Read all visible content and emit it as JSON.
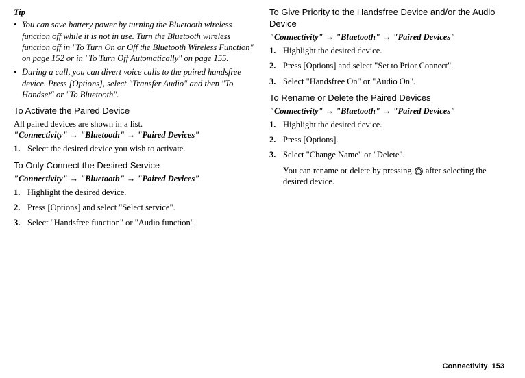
{
  "left": {
    "tipLabel": "Tip",
    "bullet1": "You can save battery power by turning the Bluetooth wireless function off while it is not in use. Turn the Bluetooth wireless function off in \"To Turn On or Off the Bluetooth Wireless Function\" on page 152 or in \"To Turn Off Automatically\" on page 155.",
    "bullet2": "During a call, you can divert voice calls to the paired handsfree device. Press [Options], select \"Transfer Audio\" and then \"To Handset\" or \"To Bluetooth\".",
    "sec1": {
      "heading": "To Activate the Paired Device",
      "intro": "All paired devices are shown in a list.",
      "path": "\"Connectivity\" → \"Bluetooth\" → \"Paired Devices\"",
      "step1num": "1.",
      "step1": "Select the desired device you wish to activate."
    },
    "sec2": {
      "heading": "To Only Connect the Desired Service",
      "path": "\"Connectivity\" → \"Bluetooth\" → \"Paired Devices\"",
      "step1num": "1.",
      "step1": "Highlight the desired device.",
      "step2num": "2.",
      "step2": "Press [Options] and select \"Select service\".",
      "step3num": "3.",
      "step3": "Select \"Handsfree function\" or \"Audio function\"."
    }
  },
  "right": {
    "sec1": {
      "heading": "To Give Priority to the Handsfree Device and/or the Audio Device",
      "path": "\"Connectivity\" → \"Bluetooth\" → \"Paired Devices\"",
      "step1num": "1.",
      "step1": "Highlight the desired device.",
      "step2num": "2.",
      "step2": "Press [Options] and select \"Set to Prior Connect\".",
      "step3num": "3.",
      "step3": "Select \"Handsfree On\" or \"Audio On\"."
    },
    "sec2": {
      "heading": "To Rename or Delete the Paired Devices",
      "path": "\"Connectivity\" → \"Bluetooth\" → \"Paired Devices\"",
      "step1num": "1.",
      "step1": "Highlight the desired device.",
      "step2num": "2.",
      "step2": "Press [Options].",
      "step3num": "3.",
      "step3": "Select \"Change Name\" or \"Delete\".",
      "notePre": "You can rename or delete by pressing ",
      "notePost": " after selecting the desired device."
    }
  },
  "footer": {
    "label": "Connectivity",
    "page": "153"
  }
}
